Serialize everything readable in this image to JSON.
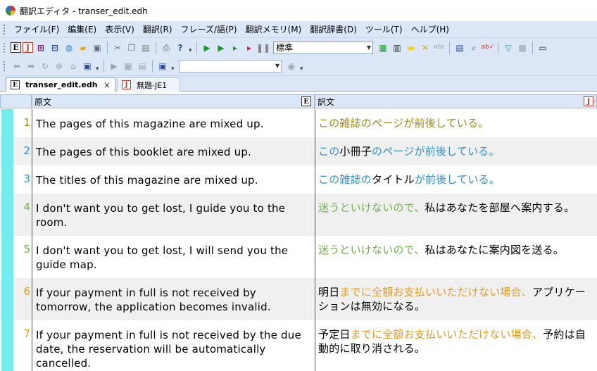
{
  "window": {
    "title": "翻訳エディタ - transer_edit.edh"
  },
  "menu": [
    "ファイル(F)",
    "編集(E)",
    "表示(V)",
    "翻訳(R)",
    "フレーズ/語(P)",
    "翻訳メモリ(M)",
    "翻訳辞書(D)",
    "ツール(T)",
    "ヘルプ(H)"
  ],
  "toolbar": {
    "style_value": "標準",
    "search_value": ""
  },
  "tabs": [
    {
      "label": "transer_edit.edh",
      "active": true,
      "close": "×"
    },
    {
      "label": "無題-JE1",
      "active": false
    }
  ],
  "columns": {
    "source": "原文",
    "target": "訳文",
    "source_badge": "E",
    "target_badge": "J"
  },
  "colors": {
    "memory_match": "#9a8a1c",
    "phrase_match": "#2f8fd0",
    "pattern_match": "#6fb24a",
    "partial_match": "#e39a22",
    "row_indicator": "#74ecec"
  },
  "rows": [
    {
      "num": "1",
      "num_color": "#9a8a1c",
      "source": "The pages of this magazine are mixed up.",
      "target": [
        {
          "t": "この雑誌のページが前後している。",
          "c": "c-olive"
        }
      ]
    },
    {
      "num": "2",
      "num_color": "#2f8fd0",
      "source": "The pages of this booklet are mixed up.",
      "target": [
        {
          "t": "この",
          "c": "c-blue"
        },
        {
          "t": "小冊子",
          "c": "c-black"
        },
        {
          "t": "のページが前後している。",
          "c": "c-blue"
        }
      ]
    },
    {
      "num": "3",
      "num_color": "#2f8fd0",
      "source": "The titles of this magazine are mixed up.",
      "target": [
        {
          "t": "この雑誌の",
          "c": "c-blue"
        },
        {
          "t": "タイトル",
          "c": "c-black"
        },
        {
          "t": "が前後している。",
          "c": "c-blue"
        }
      ]
    },
    {
      "num": "4",
      "num_color": "#6fb24a",
      "source": "I don't want you to get lost, I guide you to the room.",
      "target": [
        {
          "t": "迷うといけないので、",
          "c": "c-green"
        },
        {
          "t": "私はあなたを部屋へ案内する。",
          "c": "c-black"
        }
      ]
    },
    {
      "num": "5",
      "num_color": "#6fb24a",
      "source": "I don't want you to get lost, I will send you the guide map.",
      "target": [
        {
          "t": "迷うといけないので、",
          "c": "c-green"
        },
        {
          "t": "私はあなたに案内図を送る。",
          "c": "c-black"
        }
      ]
    },
    {
      "num": "6",
      "num_color": "#e39a22",
      "source": "If your payment in full is not received by tomorrow, the application becomes invalid.",
      "target": [
        {
          "t": "明日",
          "c": "c-black"
        },
        {
          "t": "までに全額お支払いいただけない場合、",
          "c": "c-orange"
        },
        {
          "t": "アプリケーションは無効になる。",
          "c": "c-black"
        }
      ]
    },
    {
      "num": "7",
      "num_color": "#e39a22",
      "source": "If your payment in full is not received by the due date, the reservation will be automatically cancelled.",
      "target": [
        {
          "t": "予定日",
          "c": "c-black"
        },
        {
          "t": "までに全額お支払いいただけない場合、",
          "c": "c-orange"
        },
        {
          "t": "予約は自動的に取り消される。",
          "c": "c-black"
        }
      ]
    }
  ]
}
